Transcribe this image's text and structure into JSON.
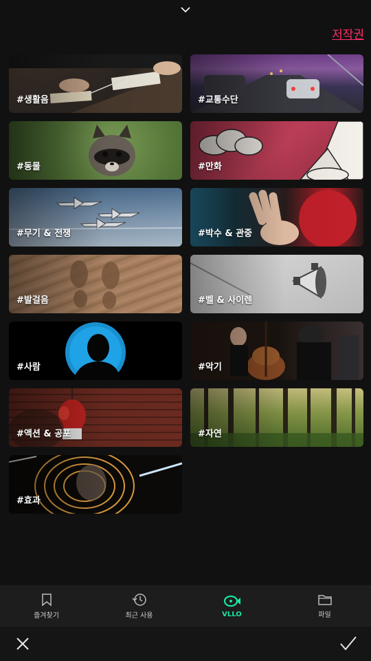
{
  "header": {
    "collapse_icon": "chevron-down-icon",
    "copyright_label": "저작권"
  },
  "categories": [
    {
      "label": "#생활음"
    },
    {
      "label": "#교통수단"
    },
    {
      "label": "#동물"
    },
    {
      "label": "#만화"
    },
    {
      "label": "#무기 & 전쟁"
    },
    {
      "label": "#박수 & 관중"
    },
    {
      "label": "#발걸음"
    },
    {
      "label": "#벨 & 사이렌"
    },
    {
      "label": "#사람"
    },
    {
      "label": "#악기"
    },
    {
      "label": "#액션 & 공포"
    },
    {
      "label": "#자연"
    },
    {
      "label": "#효과"
    }
  ],
  "bottom_tabs": [
    {
      "label": "즐겨찾기",
      "icon": "bookmark-icon"
    },
    {
      "label": "최근 사용",
      "icon": "history-icon"
    },
    {
      "label": "VLLO",
      "icon": "vllo-logo-icon"
    },
    {
      "label": "파일",
      "icon": "folder-icon"
    }
  ],
  "colors": {
    "accent_copyright": "#ff2d6a",
    "accent_active_tab": "#19e6a0",
    "background": "#111111"
  },
  "actions": {
    "close_icon": "close-icon",
    "confirm_icon": "check-icon"
  }
}
